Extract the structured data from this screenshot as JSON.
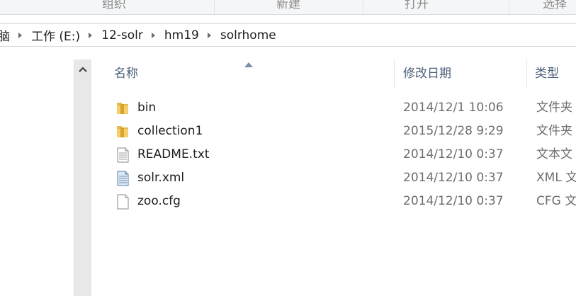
{
  "ribbon": {
    "groups": [
      "组织",
      "新建",
      "打开",
      "选择"
    ]
  },
  "breadcrumb": {
    "items": [
      "脑",
      "工作 (E:)",
      "12-solr",
      "hm19",
      "solrhome"
    ]
  },
  "file_list": {
    "columns": {
      "name": "名称",
      "date": "修改日期",
      "type": "类型"
    },
    "sort_column": "name",
    "rows": [
      {
        "name": "bin",
        "date": "2014/12/1 10:06",
        "type": "文件夹",
        "icon": "folder-icon"
      },
      {
        "name": "collection1",
        "date": "2015/12/28 9:29",
        "type": "文件夹",
        "icon": "folder-icon"
      },
      {
        "name": "README.txt",
        "date": "2014/12/10 0:37",
        "type": "文本文",
        "icon": "text-file-icon"
      },
      {
        "name": "solr.xml",
        "date": "2014/12/10 0:37",
        "type": "XML 文",
        "icon": "xml-file-icon"
      },
      {
        "name": "zoo.cfg",
        "date": "2014/12/10 0:37",
        "type": "CFG 文",
        "icon": "blank-file-icon"
      }
    ]
  },
  "colors": {
    "folder": "#e8b84a",
    "header_text": "#4c607a",
    "date_text": "#6d6d6d",
    "scrollbar": "#e8e8e8"
  }
}
